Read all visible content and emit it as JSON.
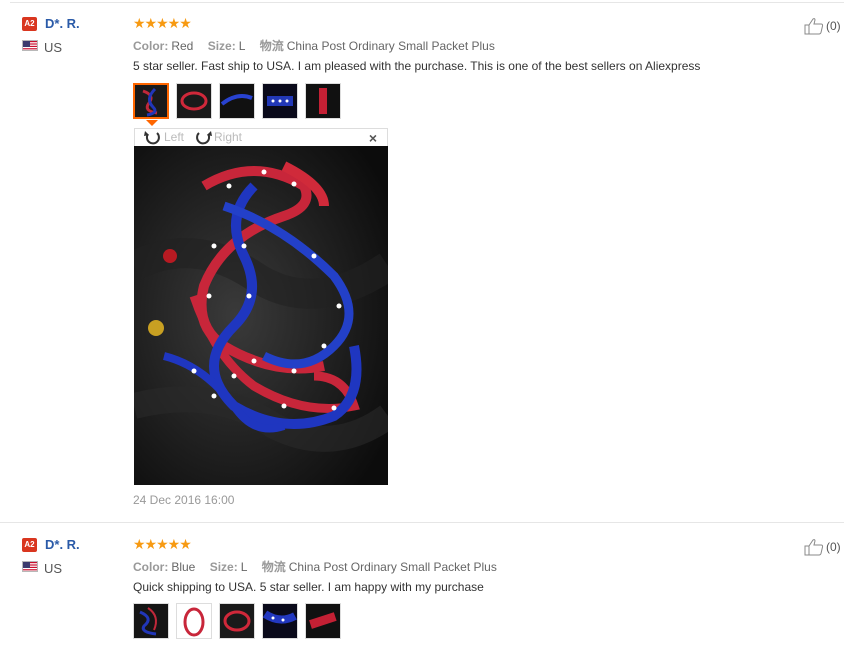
{
  "reviews": [
    {
      "badge": "A2",
      "name": "D*. R.",
      "country": "US",
      "rating_stars": "★★★★★",
      "rating": 5,
      "color_label": "Color:",
      "color_value": "Red",
      "size_label": "Size:",
      "size_value": "L",
      "shipping_label": "物流",
      "shipping_value": "China Post Ordinary Small Packet Plus",
      "text": "5 star seller. Fast ship to USA. I am pleased with the purchase. This is one of the best sellers on Aliexpress",
      "thumbnail_count": 5,
      "viewer": {
        "rotate_left": "Left",
        "rotate_right": "Right",
        "close": "×"
      },
      "date": "24 Dec 2016 16:00",
      "helpful_count": "(0)"
    },
    {
      "badge": "A2",
      "name": "D*. R.",
      "country": "US",
      "rating_stars": "★★★★★",
      "rating": 5,
      "color_label": "Color:",
      "color_value": "Blue",
      "size_label": "Size:",
      "size_value": "L",
      "shipping_label": "物流",
      "shipping_value": "China Post Ordinary Small Packet Plus",
      "text": "Quick shipping to USA. 5 star seller. I am happy with my purchase",
      "thumbnail_count": 5,
      "helpful_count": "(0)"
    }
  ],
  "colors": {
    "star": "#f79a12",
    "name_link": "#2a5aa8",
    "badge": "#d9361f",
    "active_thumb": "#ff6600"
  },
  "icons": {
    "helpful": "thumbs-up-icon",
    "rotate_left": "rotate-left-icon",
    "rotate_right": "rotate-right-icon",
    "close": "close-icon",
    "flag": "us-flag-icon"
  }
}
